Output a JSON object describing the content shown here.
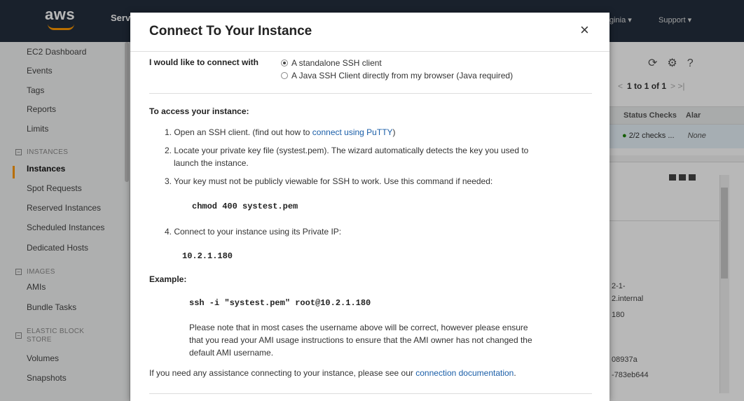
{
  "nav": {
    "logo": "aws",
    "services": "Serv",
    "region": "ginia ▾",
    "support": "Support ▾"
  },
  "sidebar": {
    "items": [
      {
        "label": "EC2 Dashboard"
      },
      {
        "label": "Events"
      },
      {
        "label": "Tags"
      },
      {
        "label": "Reports"
      },
      {
        "label": "Limits"
      }
    ],
    "section_instances": "INSTANCES",
    "instances_items": [
      {
        "label": "Instances"
      },
      {
        "label": "Spot Requests"
      },
      {
        "label": "Reserved Instances"
      },
      {
        "label": "Scheduled Instances"
      },
      {
        "label": "Dedicated Hosts"
      }
    ],
    "section_images": "IMAGES",
    "images_items": [
      {
        "label": "AMIs"
      },
      {
        "label": "Bundle Tasks"
      }
    ],
    "section_ebs": "ELASTIC BLOCK STORE",
    "ebs_items": [
      {
        "label": "Volumes"
      },
      {
        "label": "Snapshots"
      }
    ]
  },
  "background": {
    "pager": "1 to 1 of 1",
    "col_status": "Status Checks",
    "col_alarm": "Alar",
    "status_value": "2/2 checks ...",
    "alarm_value": "None",
    "detail_values": [
      "2-1-",
      "2.internal",
      "180",
      "08937a",
      "-783eb644"
    ]
  },
  "modal": {
    "title": "Connect To Your Instance",
    "close": "×",
    "connect_label": "I would like to connect with",
    "option_standalone": "A standalone SSH client",
    "option_java": "A Java SSH Client directly from my browser (Java required)",
    "access_heading": "To access your instance:",
    "step1_prefix": "1. Open an SSH client. (find out how to ",
    "step1_link": "connect using PuTTY",
    "step1_suffix": ")",
    "step2_line1": "2. Locate your private key file (systest.pem). The wizard automatically detects the key you used to",
    "step2_line2": "launch the instance.",
    "step3": "3. Your key must not be publicly viewable for SSH to work. Use this command if needed:",
    "chmod_cmd": "chmod 400 systest.pem",
    "step4": "4. Connect to your instance using its Private IP:",
    "private_ip": "10.2.1.180",
    "example_heading": "Example:",
    "ssh_cmd": "ssh -i \"systest.pem\" root@10.2.1.180",
    "note_line1": "Please note that in most cases the username above will be correct, however please ensure",
    "note_line2": "that you read your AMI usage instructions to ensure that the AMI owner has not changed the",
    "note_line3": "default AMI username.",
    "assist_prefix": "If you need any assistance connecting to your instance, please see our ",
    "assist_link": "connection documentation",
    "assist_suffix": "."
  }
}
